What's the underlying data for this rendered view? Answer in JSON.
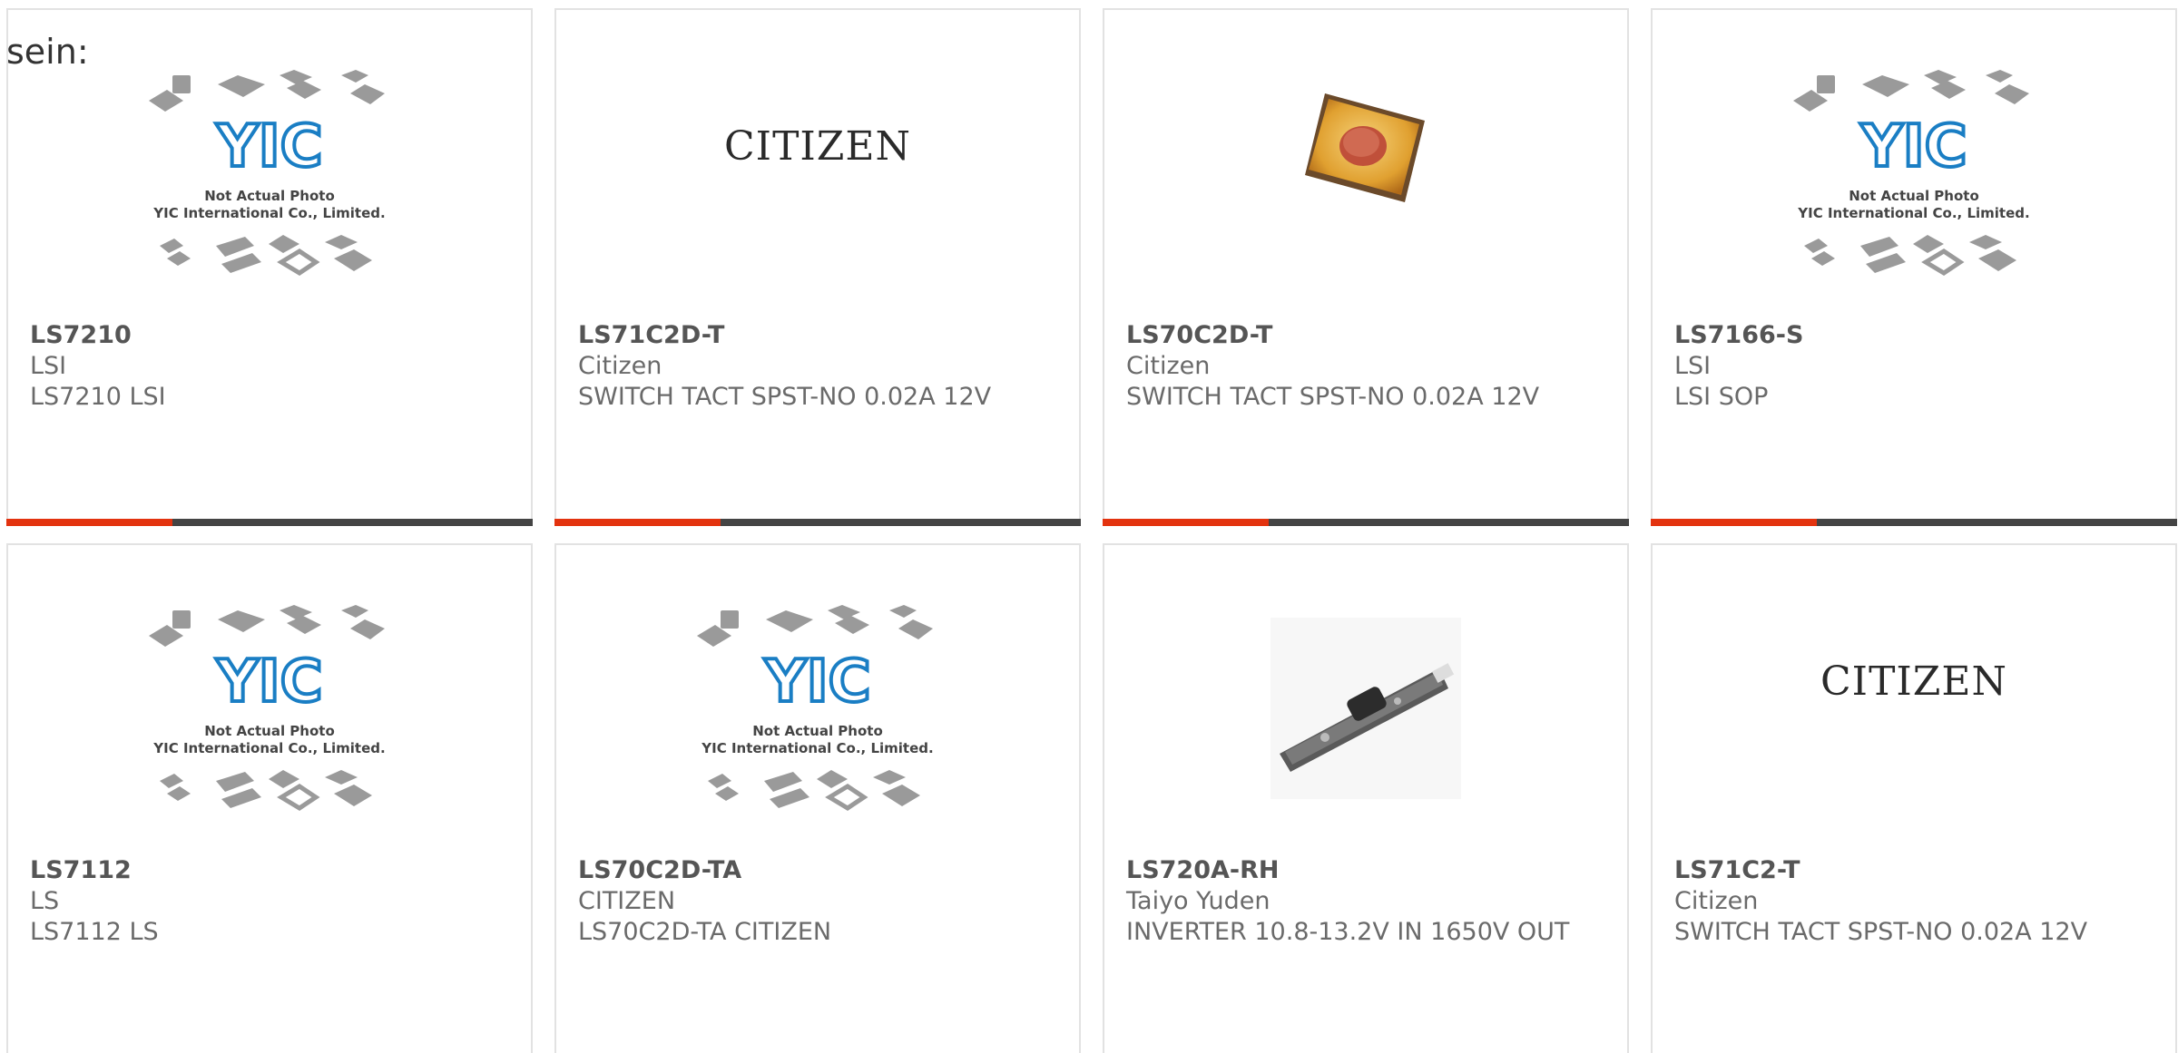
{
  "header": {
    "fragment": "sein:"
  },
  "placeholder": {
    "yic_line1": "Not Actual Photo",
    "yic_line2": "YIC International Co., Limited.",
    "yic_logo": "YIC",
    "citizen_logo": "CITIZEN"
  },
  "colors": {
    "accent": "#e3330f",
    "bar": "#444444",
    "logo_blue": "#1a7ec4"
  },
  "products": [
    {
      "part": "LS7210",
      "manufacturer": "LSI",
      "description": "LS7210 LSI",
      "image": "yic-placeholder"
    },
    {
      "part": "LS71C2D-T",
      "manufacturer": "Citizen",
      "description": "SWITCH TACT SPST-NO 0.02A 12V",
      "image": "citizen-logo"
    },
    {
      "part": "LS70C2D-T",
      "manufacturer": "Citizen",
      "description": "SWITCH TACT SPST-NO 0.02A 12V",
      "image": "tact-switch-photo"
    },
    {
      "part": "LS7166-S",
      "manufacturer": "LSI",
      "description": "LSI SOP",
      "image": "yic-placeholder"
    },
    {
      "part": "LS7112",
      "manufacturer": "LS",
      "description": "LS7112 LS",
      "image": "yic-placeholder"
    },
    {
      "part": "LS70C2D-TA",
      "manufacturer": "CITIZEN",
      "description": "LS70C2D-TA CITIZEN",
      "image": "yic-placeholder"
    },
    {
      "part": "LS720A-RH",
      "manufacturer": "Taiyo Yuden",
      "description": "INVERTER 10.8-13.2V IN 1650V OUT",
      "image": "inverter-board-photo"
    },
    {
      "part": "LS71C2-T",
      "manufacturer": "Citizen",
      "description": "SWITCH TACT SPST-NO 0.02A 12V",
      "image": "citizen-logo"
    }
  ]
}
